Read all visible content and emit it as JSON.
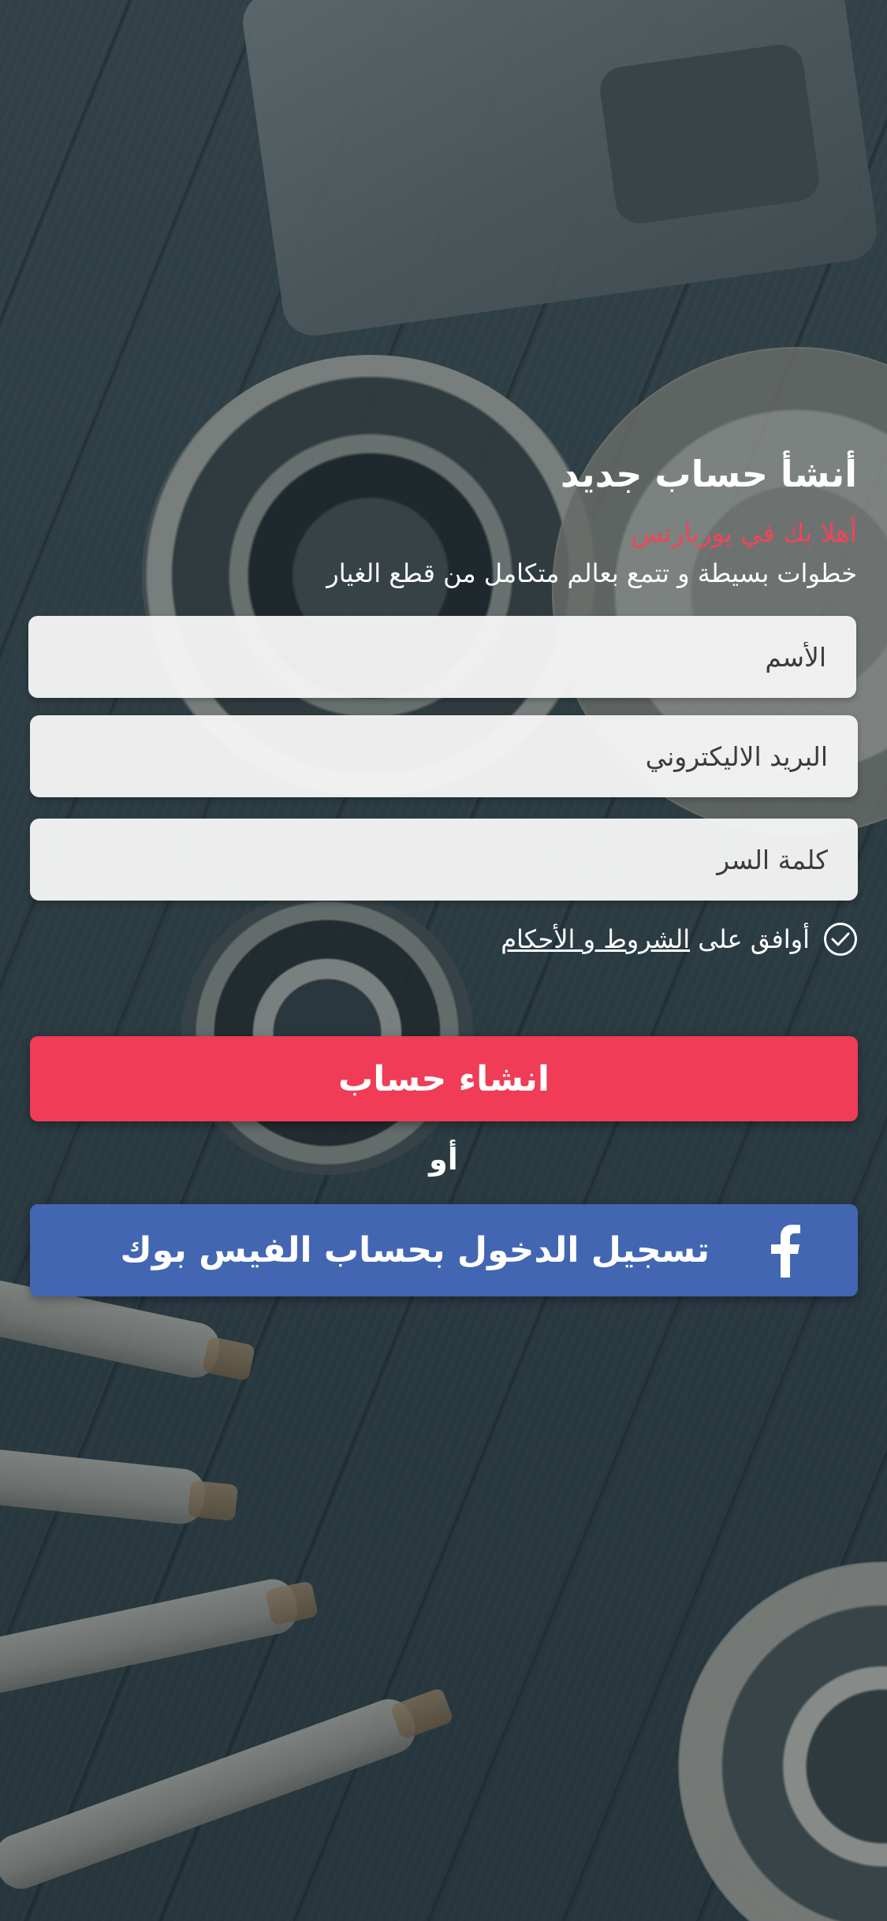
{
  "signup": {
    "title": "أنشأ حساب جديد",
    "welcome": "أهلا بك في يوربارتس",
    "subtitle": "خطوات بسيطة و تتمع بعالم متكامل من قطع الغيار"
  },
  "form": {
    "name_placeholder": "الأسم",
    "email_placeholder": "البريد الاليكتروني",
    "password_placeholder": "كلمة السر",
    "terms_prefix": "أوافق على ",
    "terms_link": "الشروط و الأحكام",
    "terms_checked": true
  },
  "actions": {
    "create_label": "انشاء حساب",
    "or_label": "أو",
    "facebook_label": "تسجيل الدخول بحساب الفيس بوك"
  },
  "colors": {
    "accent_red": "#f03c56",
    "facebook_blue": "#4266b2",
    "welcome_text": "#f04559"
  },
  "icons": {
    "check": "check-circle-icon",
    "facebook": "facebook-icon"
  }
}
